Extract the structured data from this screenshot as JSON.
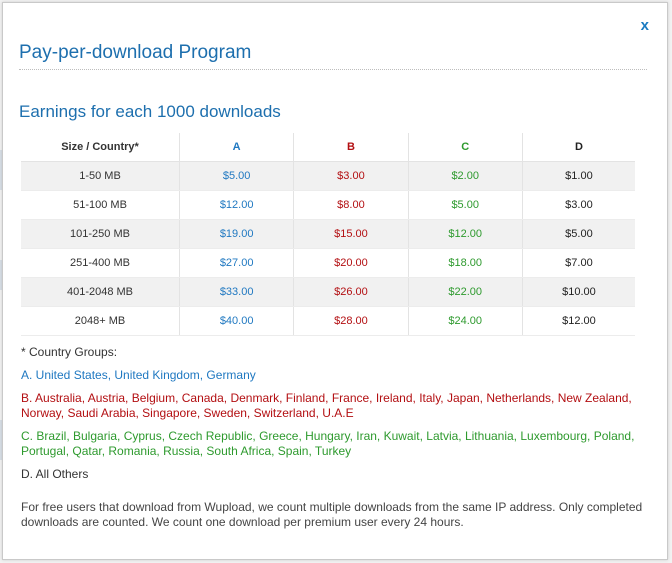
{
  "modal": {
    "close_label": "x",
    "title": "Pay-per-download Program",
    "subtitle": "Earnings for each 1000 downloads"
  },
  "table": {
    "headers": [
      "Size / Country*",
      "A",
      "B",
      "C",
      "D"
    ],
    "rows": [
      [
        "1-50 MB",
        "$5.00",
        "$3.00",
        "$2.00",
        "$1.00"
      ],
      [
        "51-100 MB",
        "$12.00",
        "$8.00",
        "$5.00",
        "$3.00"
      ],
      [
        "101-250 MB",
        "$19.00",
        "$15.00",
        "$12.00",
        "$5.00"
      ],
      [
        "251-400 MB",
        "$27.00",
        "$20.00",
        "$18.00",
        "$7.00"
      ],
      [
        "401-2048 MB",
        "$33.00",
        "$26.00",
        "$22.00",
        "$10.00"
      ],
      [
        "2048+ MB",
        "$40.00",
        "$28.00",
        "$24.00",
        "$12.00"
      ]
    ]
  },
  "groups": {
    "heading": "* Country Groups:",
    "a": "A.  United States, United Kingdom, Germany",
    "b": "B.  Australia, Austria, Belgium, Canada, Denmark, Finland, France, Ireland, Italy, Japan, Netherlands, New Zealand, Norway, Saudi Arabia, Singapore, Sweden, Switzerland, U.A.E",
    "c": "C.  Brazil, Bulgaria, Cyprus, Czech Republic, Greece, Hungary, Iran, Kuwait, Latvia, Lithuania, Luxembourg, Poland, Portugal, Qatar, Romania, Russia, South Africa, Spain, Turkey",
    "d": "D.  All Others"
  },
  "footer_note": "For free users that download from Wupload, we count multiple downloads from the same IP address. Only completed downloads are counted. We count one download per premium user every 24 hours.",
  "colors": {
    "group_a": "#1f78c1",
    "group_b": "#b30f12",
    "group_c": "#2e9a2e",
    "title": "#1d6fae"
  }
}
